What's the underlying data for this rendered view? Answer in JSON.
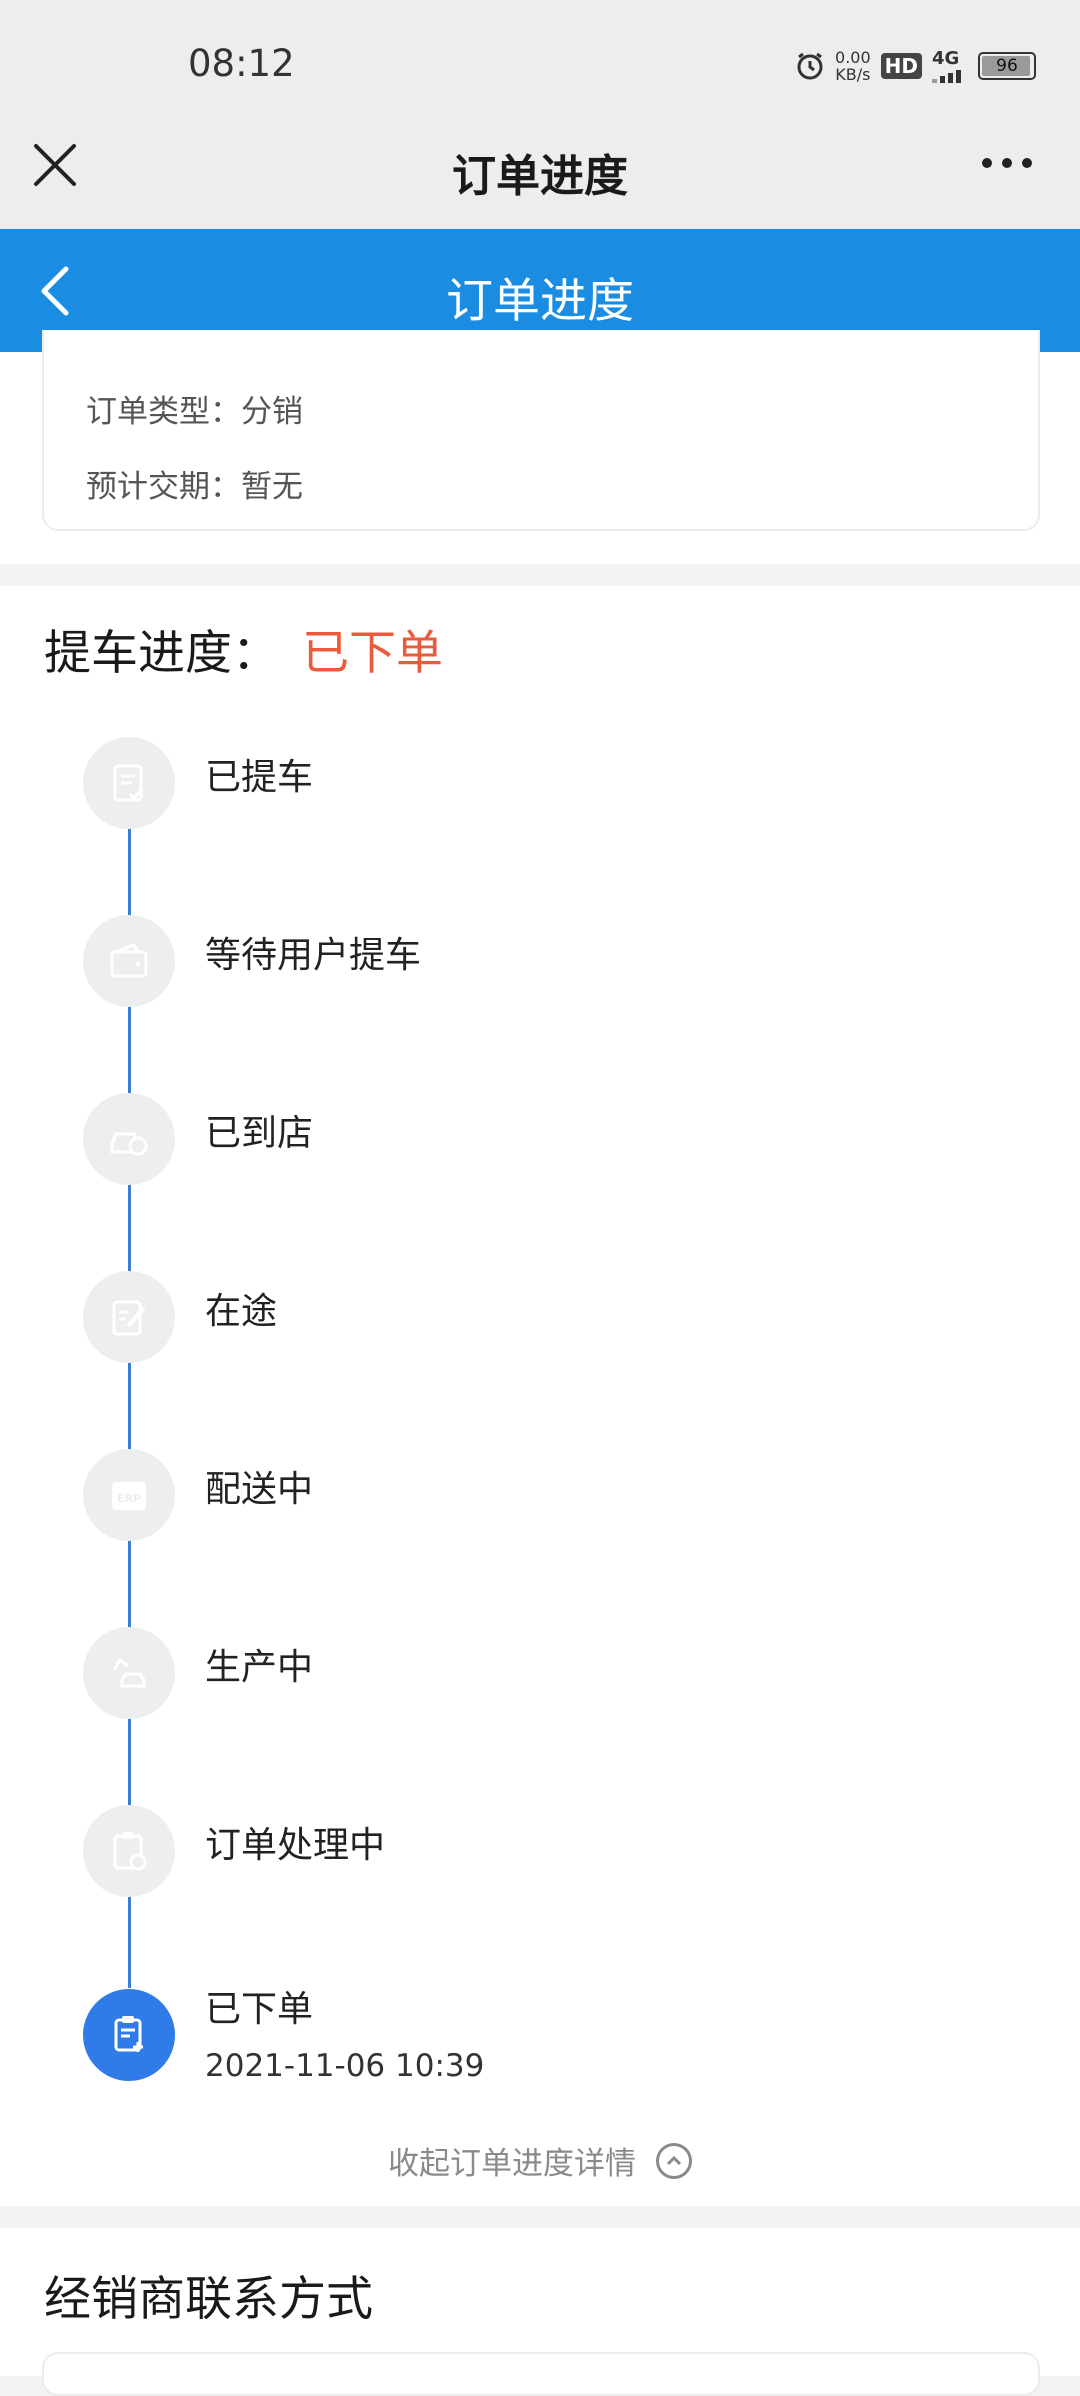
{
  "status_bar": {
    "time": "08:12",
    "net_speed_value": "0.00",
    "net_speed_unit": "KB/s",
    "hd_label": "HD",
    "signal_label": "4G",
    "battery": "96"
  },
  "nav": {
    "title": "订单进度"
  },
  "header": {
    "title": "订单进度"
  },
  "info": {
    "order_type": "订单类型：分销",
    "delivery_date": "预计交期：暂无"
  },
  "progress": {
    "title": "提车进度：",
    "status": "已下单",
    "steps": [
      {
        "label": "已提车",
        "icon": "document-check-icon",
        "active": false
      },
      {
        "label": "等待用户提车",
        "icon": "wallet-icon",
        "active": false
      },
      {
        "label": "已到店",
        "icon": "car-store-icon",
        "active": false
      },
      {
        "label": "在途",
        "icon": "edit-note-icon",
        "active": false
      },
      {
        "label": "配送中",
        "icon": "erp-box-icon",
        "active": false
      },
      {
        "label": "生产中",
        "icon": "robot-arm-car-icon",
        "active": false
      },
      {
        "label": "订单处理中",
        "icon": "clipboard-clock-icon",
        "active": false
      },
      {
        "label": "已下单",
        "icon": "clipboard-plus-icon",
        "active": true,
        "time": "2021-11-06 10:39"
      }
    ],
    "collapse_label": "收起订单进度详情"
  },
  "dealer": {
    "title": "经销商联系方式"
  },
  "colors": {
    "brand_blue": "#1a8de3",
    "status_red": "#ec5a3c",
    "active_step": "#2f7ce8",
    "timeline": "#3d7ed3"
  }
}
